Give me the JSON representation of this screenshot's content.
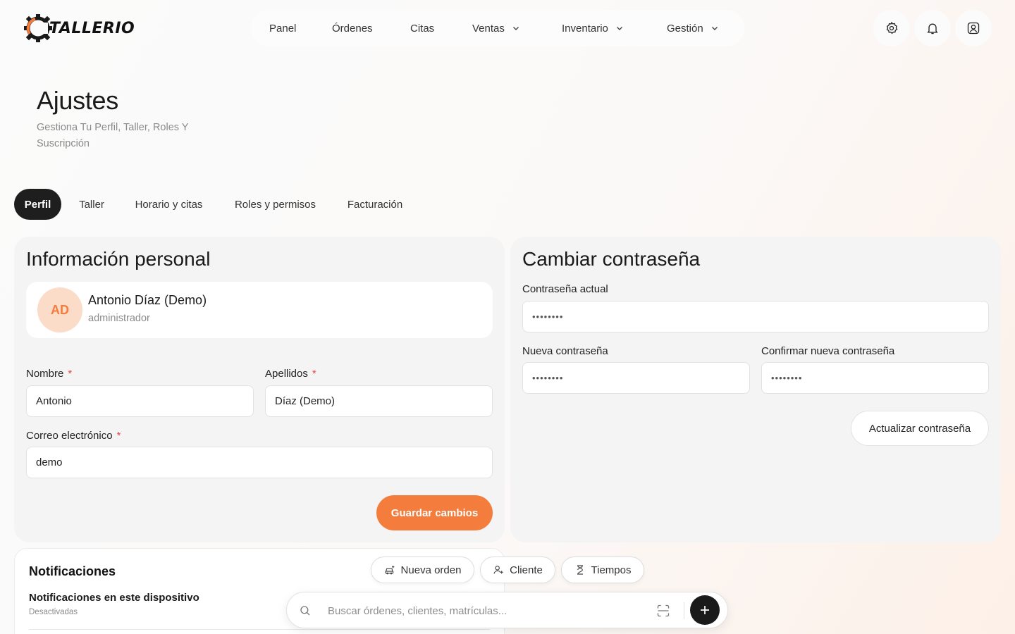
{
  "brand": {
    "name": "TALLERIO",
    "accent": "#f47c3c",
    "dark": "#1e1e1e"
  },
  "nav": {
    "items": [
      {
        "label": "Panel",
        "has_dropdown": false
      },
      {
        "label": "Órdenes",
        "has_dropdown": false
      },
      {
        "label": "Citas",
        "has_dropdown": false
      },
      {
        "label": "Ventas",
        "has_dropdown": true
      },
      {
        "label": "Inventario",
        "has_dropdown": true
      },
      {
        "label": "Gestión",
        "has_dropdown": true
      }
    ]
  },
  "header_actions": [
    "settings-icon",
    "bell-icon",
    "user-icon"
  ],
  "page": {
    "title": "Ajustes",
    "subtitle": "Gestiona Tu Perfil, Taller, Roles Y Suscripción"
  },
  "tabs": {
    "active": "Perfil",
    "items": [
      "Perfil",
      "Taller",
      "Horario y citas",
      "Roles y permisos",
      "Facturación"
    ]
  },
  "personal": {
    "title": "Información personal",
    "avatar_initials": "AD",
    "full_name": "Antonio Díaz (Demo)",
    "role": "administrador",
    "first_name_label": "Nombre",
    "first_name_value": "Antonio",
    "last_name_label": "Apellidos",
    "last_name_value": "Díaz (Demo)",
    "email_label": "Correo electrónico",
    "email_value": "demo",
    "required_mark": "*",
    "save_label": "Guardar cambios"
  },
  "password": {
    "title": "Cambiar contraseña",
    "current_label": "Contraseña actual",
    "current_value": "••••••••",
    "new_label": "Nueva contraseña",
    "new_value": "••••••••",
    "confirm_label": "Confirmar nueva contraseña",
    "confirm_value": "••••••••",
    "update_label": "Actualizar contraseña"
  },
  "notifications": {
    "title": "Notificaciones",
    "device_title": "Notificaciones en este dispositivo",
    "device_status": "Desactivadas"
  },
  "quickbar": {
    "chips": [
      {
        "label": "Nueva orden",
        "icon": "car-plus-icon"
      },
      {
        "label": "Cliente",
        "icon": "user-plus-icon"
      },
      {
        "label": "Tiempos",
        "icon": "hourglass-icon"
      }
    ],
    "search_placeholder": "Buscar órdenes, clientes, matrículas..."
  }
}
